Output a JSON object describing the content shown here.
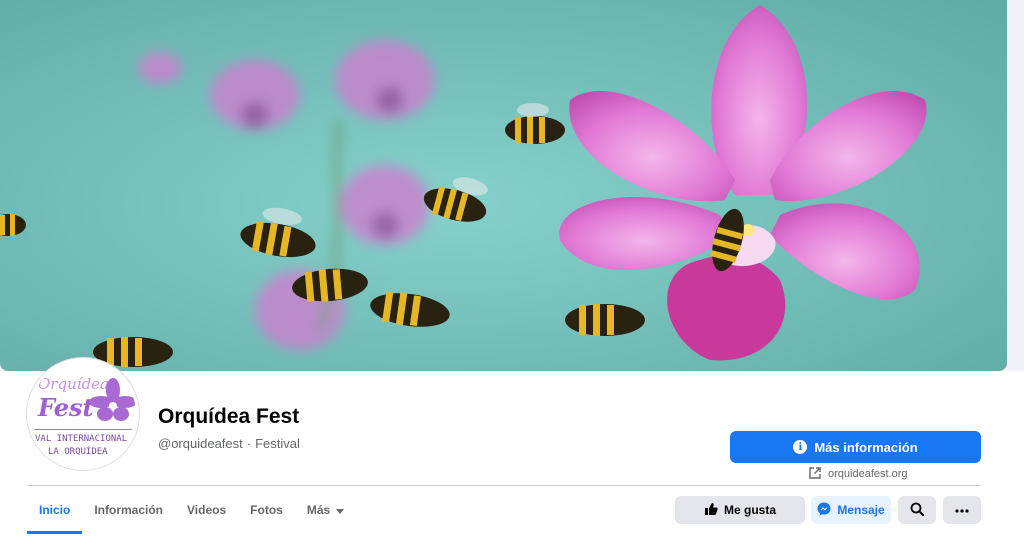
{
  "page": {
    "name": "Orquídea Fest",
    "handle": "@orquideafest",
    "category": "Festival",
    "separator": "·"
  },
  "avatar": {
    "logo_word_1": "Orquídea",
    "logo_word_2": "Fest",
    "logo_line_1": "VAL INTERNACIONAL D",
    "logo_line_2": "LA ORQUÍDEA"
  },
  "cta": {
    "primary_label": "Más información",
    "primary_icon": "info-icon",
    "website": "orquideafest.org",
    "website_icon": "external-link-icon"
  },
  "tabs": [
    {
      "label": "Inicio",
      "active": true
    },
    {
      "label": "Información",
      "active": false
    },
    {
      "label": "Videos",
      "active": false
    },
    {
      "label": "Fotos",
      "active": false
    },
    {
      "label": "Más",
      "active": false
    }
  ],
  "actions": {
    "like_label": "Me gusta",
    "like_icon": "thumbs-up-icon",
    "message_label": "Mensaje",
    "message_icon": "messenger-icon",
    "search_icon": "search-icon",
    "more_icon": "more-dots-icon"
  },
  "colors": {
    "accent": "#1877f2",
    "cover_bg": "#7cc6c0",
    "orchid": "#d65fc6",
    "logo_purple": "#a86ad2"
  }
}
